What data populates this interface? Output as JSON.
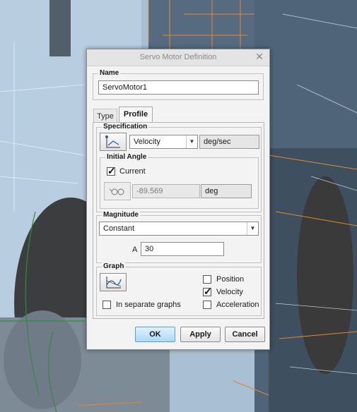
{
  "dialog": {
    "title": "Servo Motor Definition",
    "close_glyph": "✕"
  },
  "name_group": {
    "legend": "Name",
    "value": "ServoMotor1"
  },
  "tabs": [
    {
      "label": "Type",
      "active": false
    },
    {
      "label": "Profile",
      "active": true
    }
  ],
  "specification": {
    "legend": "Specification",
    "icon": "velocity-profile-icon",
    "selected": "Velocity",
    "unit": "deg/sec"
  },
  "initial_angle": {
    "legend": "Initial Angle",
    "current_label": "Current",
    "current_checked": true,
    "icon": "glasses-icon",
    "value": "-89.569",
    "unit": "deg"
  },
  "magnitude": {
    "legend": "Magnitude",
    "selected": "Constant",
    "a_label": "A",
    "a_value": "30"
  },
  "graph": {
    "legend": "Graph",
    "icon": "graph-icon",
    "separate_label": "In separate graphs",
    "separate_checked": false,
    "position_label": "Position",
    "position_checked": false,
    "velocity_label": "Velocity",
    "velocity_checked": true,
    "acceleration_label": "Acceleration",
    "acceleration_checked": false
  },
  "buttons": {
    "ok": "OK",
    "apply": "Apply",
    "cancel": "Cancel"
  },
  "colors": {
    "accent": "#5a9fd4",
    "model_blue": "#9db3c9",
    "edge_orange": "#e08a2a",
    "edge_green": "#2e8b3c"
  }
}
